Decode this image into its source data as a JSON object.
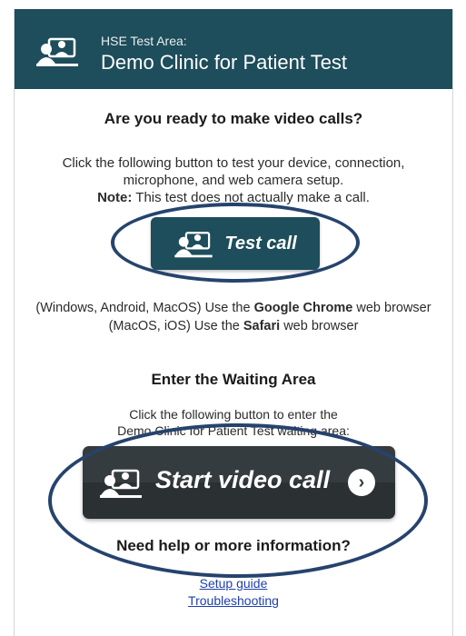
{
  "header": {
    "area_label": "HSE Test Area:",
    "clinic_name": "Demo Clinic for Patient Test"
  },
  "test_section": {
    "heading": "Are you ready to make video calls?",
    "description_line1": "Click the following button to test your device, connection,",
    "description_line2": "microphone, and web camera setup.",
    "note_label": "Note:",
    "note_text": " This test does not actually make a call.",
    "button_label": "Test call"
  },
  "browsers": {
    "line1_prefix": "(Windows, Android, MacOS) Use the ",
    "line1_browser": "Google Chrome",
    "line1_suffix": " web browser",
    "line2_prefix": "(MacOS, iOS) Use the ",
    "line2_browser": "Safari",
    "line2_suffix": " web browser"
  },
  "waiting_section": {
    "heading": "Enter the Waiting Area",
    "description_line1": "Click the following button to enter the",
    "description_line2": "Demo Clinic for Patient Test waiting area:",
    "button_label": "Start video call"
  },
  "help_section": {
    "heading": "Need help or more information?",
    "links": [
      "Setup guide",
      "Troubleshooting"
    ]
  },
  "colors": {
    "header_bg": "#1e4d5b",
    "start_button_bg": "#353c3f",
    "annotation_oval": "#26436d",
    "link": "#1f3fae"
  },
  "icons": {
    "logo": "video-call-people-icon",
    "arrow": "chevron-right-circle-icon"
  }
}
